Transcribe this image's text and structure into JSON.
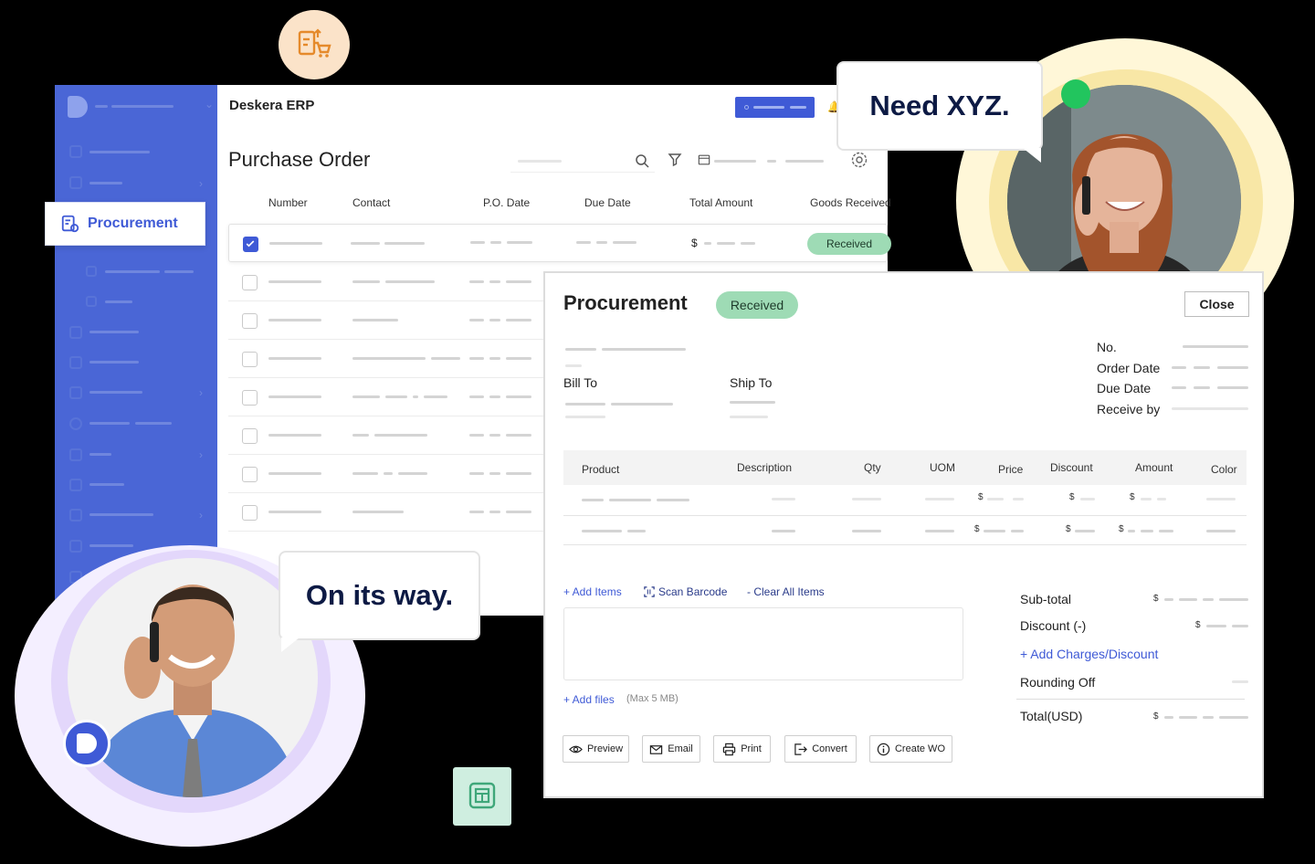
{
  "app": {
    "title": "Deskera ERP"
  },
  "sidebar": {
    "active_label": "Procurement"
  },
  "list": {
    "title": "Purchase Order",
    "columns": [
      "Number",
      "Contact",
      "P.O. Date",
      "Due Date",
      "Total Amount",
      "Goods Received"
    ],
    "first_row": {
      "currency": "$",
      "status": "Received"
    }
  },
  "detail": {
    "title": "Procurement",
    "status": "Received",
    "close_label": "Close",
    "bill_to": "Bill To",
    "ship_to": "Ship To",
    "meta_labels": {
      "no": "No.",
      "order_date": "Order Date",
      "due_date": "Due Date",
      "receive_by": "Receive by"
    },
    "table_headers": {
      "product": "Product",
      "description": "Description",
      "qty": "Qty",
      "uom": "UOM",
      "price": "Price",
      "discount": "Discount",
      "amount": "Amount",
      "color": "Color"
    },
    "currency": "$",
    "actions": {
      "add_items": "+ Add Items",
      "scan_barcode": "Scan Barcode",
      "clear_all": "- Clear All Items",
      "add_files": "+ Add files",
      "max_size": "(Max 5 MB)"
    },
    "totals": {
      "subtotal": "Sub-total",
      "discount": "Discount (-)",
      "add_charges": "+ Add Charges/Discount",
      "rounding": "Rounding Off",
      "total": "Total(USD)"
    },
    "buttons": {
      "preview": "Preview",
      "email": "Email",
      "print": "Print",
      "convert": "Convert",
      "create_wo": "Create WO"
    }
  },
  "bubbles": {
    "top": "Need XYZ.",
    "bottom": "On its way."
  },
  "colors": {
    "primary": "#3f5ad6",
    "sidebar": "#4a66d6",
    "received_bg": "#9edbb5",
    "accent_orange": "#fbe3c9",
    "accent_green": "#cfeee0"
  }
}
